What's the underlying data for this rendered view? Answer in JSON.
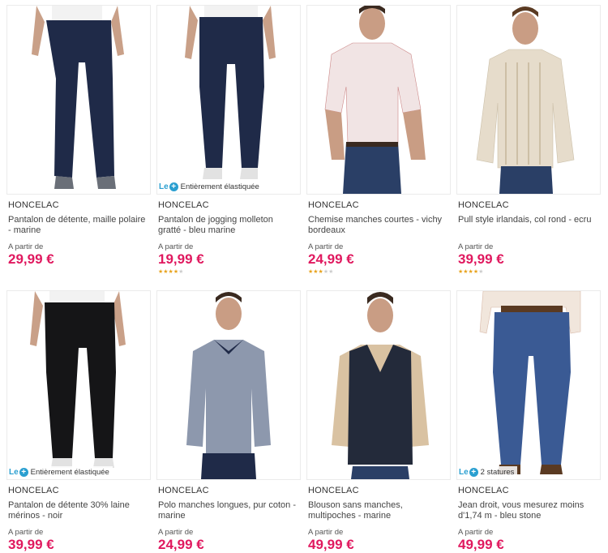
{
  "products": [
    {
      "brand": "HONCELAC",
      "name": "Pantalon de détente, maille polaire - marine",
      "from": "A partir de",
      "price": "29,99 €",
      "badge": "",
      "rating": 0
    },
    {
      "brand": "HONCELAC",
      "name": "Pantalon de jogging molleton gratté - bleu marine",
      "from": "A partir de",
      "price": "19,99 €",
      "badge": "Entièrement élastiquée",
      "rating": 4
    },
    {
      "brand": "HONCELAC",
      "name": "Chemise manches courtes - vichy bordeaux",
      "from": "A partir de",
      "price": "24,99 €",
      "badge": "",
      "rating": 3
    },
    {
      "brand": "HONCELAC",
      "name": "Pull style irlandais, col rond - ecru",
      "from": "A partir de",
      "price": "39,99 €",
      "badge": "",
      "rating": 4
    },
    {
      "brand": "HONCELAC",
      "name": "Pantalon de détente 30% laine mérinos - noir",
      "from": "A partir de",
      "price": "39,99 €",
      "badge": "Entièrement élastiquée",
      "rating": 0
    },
    {
      "brand": "HONCELAC",
      "name": "Polo manches longues, pur coton - marine",
      "from": "A partir de",
      "price": "24,99 €",
      "badge": "",
      "rating": 0
    },
    {
      "brand": "HONCELAC",
      "name": "Blouson sans manches, multipoches - marine",
      "from": "A partir de",
      "price": "49,99 €",
      "badge": "",
      "rating": 0
    },
    {
      "brand": "HONCELAC",
      "name": "Jean droit, vous mesurez moins d'1,74 m - bleu stone",
      "from": "A partir de",
      "price": "49,99 €",
      "badge": "2 statures",
      "rating": 0
    }
  ],
  "badge_prefix": "Le",
  "badge_plus": "+",
  "colors": {
    "price": "#e0195f",
    "badge": "#2a9fd0",
    "star": "#e8a31d"
  }
}
